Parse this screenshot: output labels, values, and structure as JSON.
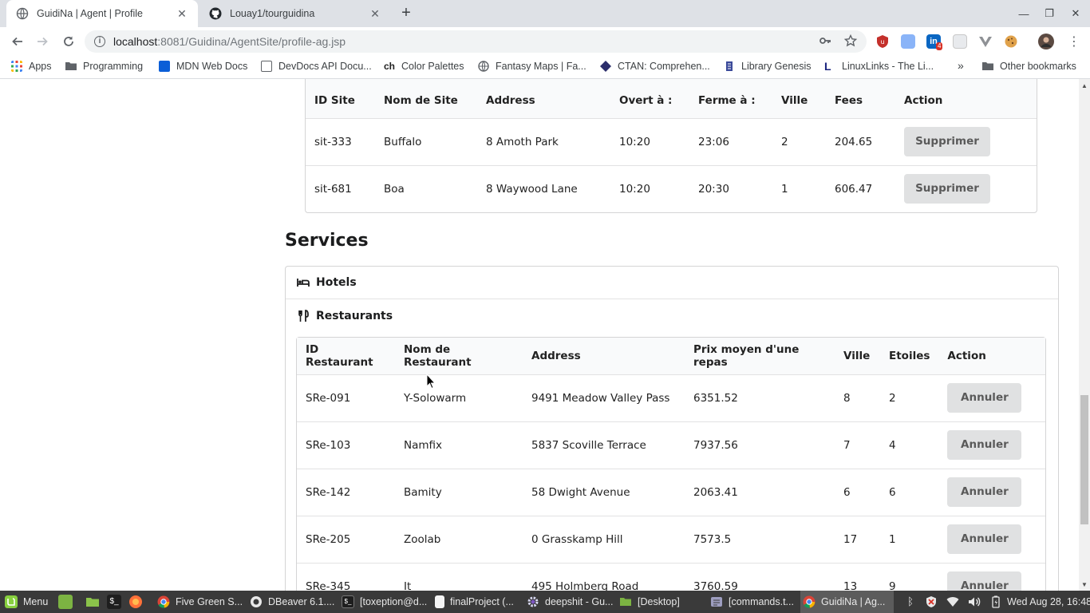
{
  "browser": {
    "tabs": [
      {
        "title": "GuidiNa | Agent | Profile",
        "active": true
      },
      {
        "title": "Louay1/tourguidina",
        "active": false
      }
    ],
    "url": {
      "host": "localhost",
      "path": ":8081/Guidina/AgentSite/profile-ag.jsp"
    },
    "extension_badge": "4",
    "bookmarks": [
      {
        "label": "Apps",
        "icon": "apps-grid-icon"
      },
      {
        "label": "Programming",
        "icon": "folder-icon"
      },
      {
        "label": "MDN Web Docs",
        "icon": "mdn-icon"
      },
      {
        "label": "DevDocs API Docu...",
        "icon": "devdocs-icon"
      },
      {
        "label": "Color Palettes",
        "icon": "coolors-icon"
      },
      {
        "label": "Fantasy Maps | Fa...",
        "icon": "globe-icon"
      },
      {
        "label": "CTAN: Comprehen...",
        "icon": "ctan-icon"
      },
      {
        "label": "Library Genesis",
        "icon": "library-icon"
      },
      {
        "label": "LinuxLinks - The Li...",
        "icon": "linuxlinks-icon"
      }
    ],
    "more_bookmarks": "»",
    "other_bookmarks": "Other bookmarks"
  },
  "sites_table": {
    "headers": [
      "ID Site",
      "Nom de Site",
      "Address",
      "Overt à :",
      "Ferme à :",
      "Ville",
      "Fees",
      "Action"
    ],
    "rows": [
      {
        "id": "sit-333",
        "name": "Buffalo",
        "address": "8 Amoth Park",
        "open": "10:20",
        "close": "23:06",
        "city": "2",
        "fees": "204.65",
        "action": "Supprimer"
      },
      {
        "id": "sit-681",
        "name": "Boa",
        "address": "8 Waywood Lane",
        "open": "10:20",
        "close": "20:30",
        "city": "1",
        "fees": "606.47",
        "action": "Supprimer"
      }
    ]
  },
  "services": {
    "title": "Services",
    "hotels_label": "Hotels",
    "restaurants_label": "Restaurants"
  },
  "restaurants_table": {
    "headers": [
      "ID Restaurant",
      "Nom de Restaurant",
      "Address",
      "Prix moyen d'une repas",
      "Ville",
      "Etoiles",
      "Action"
    ],
    "rows": [
      {
        "id": "SRe-091",
        "name": "Y-Solowarm",
        "address": "9491 Meadow Valley Pass",
        "price": "6351.52",
        "city": "8",
        "stars": "2",
        "action": "Annuler"
      },
      {
        "id": "SRe-103",
        "name": "Namfix",
        "address": "5837 Scoville Terrace",
        "price": "7937.56",
        "city": "7",
        "stars": "4",
        "action": "Annuler"
      },
      {
        "id": "SRe-142",
        "name": "Bamity",
        "address": "58 Dwight Avenue",
        "price": "2063.41",
        "city": "6",
        "stars": "6",
        "action": "Annuler"
      },
      {
        "id": "SRe-205",
        "name": "Zoolab",
        "address": "0 Grasskamp Hill",
        "price": "7573.5",
        "city": "17",
        "stars": "1",
        "action": "Annuler"
      },
      {
        "id": "SRe-345",
        "name": "It",
        "address": "495 Holmberg Road",
        "price": "3760.59",
        "city": "13",
        "stars": "9",
        "action": "Annuler"
      }
    ]
  },
  "taskbar": {
    "menu_label": "Menu",
    "windows": [
      {
        "label": "Five Green S...",
        "icon": "chrome-icon"
      },
      {
        "label": "DBeaver 6.1....",
        "icon": "dbeaver-icon"
      },
      {
        "label": "[toxeption@d...",
        "icon": "terminal-icon"
      },
      {
        "label": "finalProject (...",
        "icon": "document-icon"
      },
      {
        "label": "deepshit - Gu...",
        "icon": "gear-icon"
      },
      {
        "label": "[Desktop]",
        "icon": "folder-icon"
      },
      {
        "label": "[commands.t...",
        "icon": "text-editor-icon"
      },
      {
        "label": "GuidiNa | Ag...",
        "icon": "chrome-icon"
      }
    ],
    "clock": "Wed Aug 28, 16:48"
  },
  "colors": {
    "button_bg": "#e0e1e2",
    "taskbar_bg": "#3a3a3a",
    "tabstrip_bg": "#dee1e6",
    "accent_red": "#d93025",
    "linkedin_blue": "#0a66c2"
  }
}
